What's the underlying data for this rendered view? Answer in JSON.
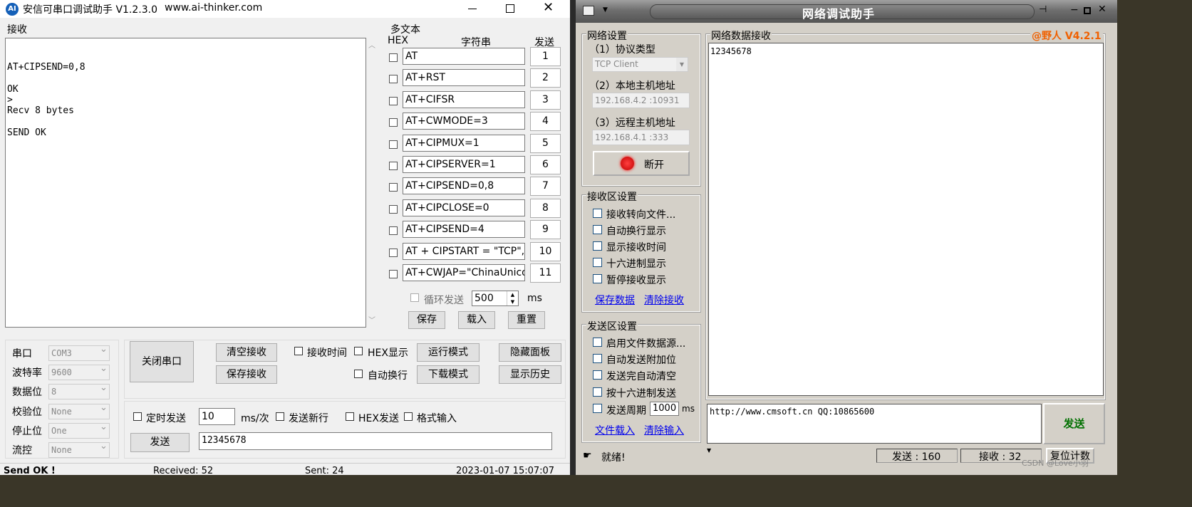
{
  "left": {
    "title": "安信可串口调试助手 V1.2.3.0",
    "url": "www.ai-thinker.com",
    "receive_label": "接收",
    "receive_lines": [
      "AT+CIPSEND=0,8",
      "",
      "OK",
      ">",
      "Recv 8 bytes",
      "",
      "SEND OK"
    ],
    "multi_label": "多文本",
    "col_hex": "HEX",
    "col_str": "字符串",
    "col_send": "发送",
    "rows": [
      {
        "text": "AT",
        "n": "1"
      },
      {
        "text": "AT+RST",
        "n": "2"
      },
      {
        "text": "AT+CIFSR",
        "n": "3"
      },
      {
        "text": "AT+CWMODE=3",
        "n": "4"
      },
      {
        "text": "AT+CIPMUX=1",
        "n": "5"
      },
      {
        "text": "AT+CIPSERVER=1",
        "n": "6"
      },
      {
        "text": "AT+CIPSEND=0,8",
        "n": "7"
      },
      {
        "text": "AT+CIPCLOSE=0",
        "n": "8"
      },
      {
        "text": "AT+CIPSEND=4",
        "n": "9"
      },
      {
        "text": "AT + CIPSTART = \"TCP\",\"",
        "n": "10"
      },
      {
        "text": "AT+CWJAP=\"ChinaUnicon",
        "n": "11"
      }
    ],
    "loop_label": "循环发送",
    "loop_ms": "500",
    "ms": "ms",
    "save": "保存",
    "load": "载入",
    "reset": "重置",
    "port_labels": [
      "串口",
      "波特率",
      "数据位",
      "校验位",
      "停止位",
      "流控"
    ],
    "port_values": [
      "COM3",
      "9600",
      "8",
      "None",
      "One",
      "None"
    ],
    "close_port": "关闭串口",
    "clear_recv": "清空接收",
    "save_recv": "保存接收",
    "recv_time": "接收时间",
    "hex_show": "HEX显示",
    "run_mode": "运行模式",
    "hide_panel": "隐藏面板",
    "auto_wrap": "自动换行",
    "download_mode": "下载模式",
    "show_history": "显示历史",
    "timed_send": "定时发送",
    "period": "10",
    "ms_per": "ms/次",
    "send_newline": "发送新行",
    "hex_send": "HEX发送",
    "fmt_input": "格式输入",
    "send": "发送",
    "send_text": "12345678",
    "status_ok": "Send OK !",
    "received": "Received: 52",
    "sent": "Sent: 24",
    "datetime": "2023-01-07 15:07:07"
  },
  "right": {
    "title": "网络调试助手",
    "net_settings": "网络设置",
    "proto_label": "（1）协议类型",
    "proto": "TCP Client",
    "local_label": "（2）本地主机地址",
    "local": "192.168.4.2 :10931",
    "remote_label": "（3）远程主机地址",
    "remote": "192.168.4.1 :333",
    "disconnect": "断开",
    "recv_settings": "接收区设置",
    "recv_opts": [
      "接收转向文件...",
      "自动换行显示",
      "显示接收时间",
      "十六进制显示",
      "暂停接收显示"
    ],
    "save_data": "保存数据",
    "clear_recv": "清除接收",
    "send_settings": "发送区设置",
    "send_opts": [
      "启用文件数据源...",
      "自动发送附加位",
      "发送完自动清空",
      "按十六进制发送"
    ],
    "send_period": "发送周期",
    "period_val": "1000",
    "ms": "ms",
    "file_load": "文件载入",
    "clear_input": "清除输入",
    "data_recv_label": "网络数据接收",
    "brand": "@野人 V4.2.1",
    "recv_text": "12345678",
    "send_text": "http://www.cmsoft.cn QQ:10865600",
    "send_btn": "发送",
    "status": "就绪!",
    "sent_label": "发送 : 160",
    "recv_label": "接收 : 32",
    "reset_count": "复位计数",
    "watermark": "CSDN @Love小羽"
  },
  "colors": {
    "accent_red": "#e04000",
    "brand_orange": "#f06000",
    "link": "#0000ee"
  }
}
